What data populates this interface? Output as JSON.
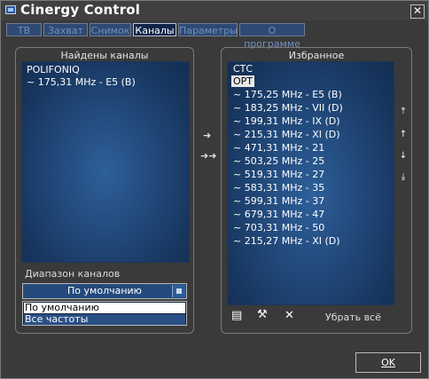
{
  "window": {
    "title": "Cinergy Control",
    "close_glyph": "✕"
  },
  "tabs": [
    {
      "label": "ТВ",
      "active": false
    },
    {
      "label": "Захват",
      "active": false
    },
    {
      "label": "Снимок",
      "active": false
    },
    {
      "label": "Каналы",
      "active": true
    },
    {
      "label": "Параметры",
      "active": false
    },
    {
      "label": "О программе",
      "active": false
    }
  ],
  "found": {
    "title": "Найдены каналы",
    "items": [
      "POLIFONIQ",
      "~ 175,31 MHz - E5 (B)"
    ]
  },
  "range": {
    "label": "Диапазон каналов",
    "selected": "По умолчанию",
    "options": [
      "По умолчанию",
      "Все частоты"
    ]
  },
  "transfer": {
    "add_one": "➜",
    "add_all": "➜➜"
  },
  "favorites": {
    "title": "Избранное",
    "items": [
      "СТС",
      "ОРТ",
      "~ 175,25 MHz - E5 (B)",
      "~ 183,25 MHz - VII (D)",
      "~ 199,31 MHz - IX (D)",
      "~ 215,31 MHz - XI (D)",
      "~ 471,31 MHz - 21",
      "~ 503,25 MHz - 25",
      "~ 519,31 MHz - 27",
      "~ 583,31 MHz - 35",
      "~ 599,31 MHz - 37",
      "~ 679,31 MHz - 47",
      "~ 703,31 MHz - 50",
      "~ 215,27 MHz - XI (D)"
    ],
    "selected_index": 1,
    "clear_all": "Убрать всё",
    "side": {
      "top": "⤒",
      "up": "↑",
      "down": "↓",
      "bottom": "⤓"
    },
    "tools": {
      "save": "▤",
      "settings": "⚒",
      "delete": "✕"
    }
  },
  "ok": {
    "label": "OK"
  }
}
